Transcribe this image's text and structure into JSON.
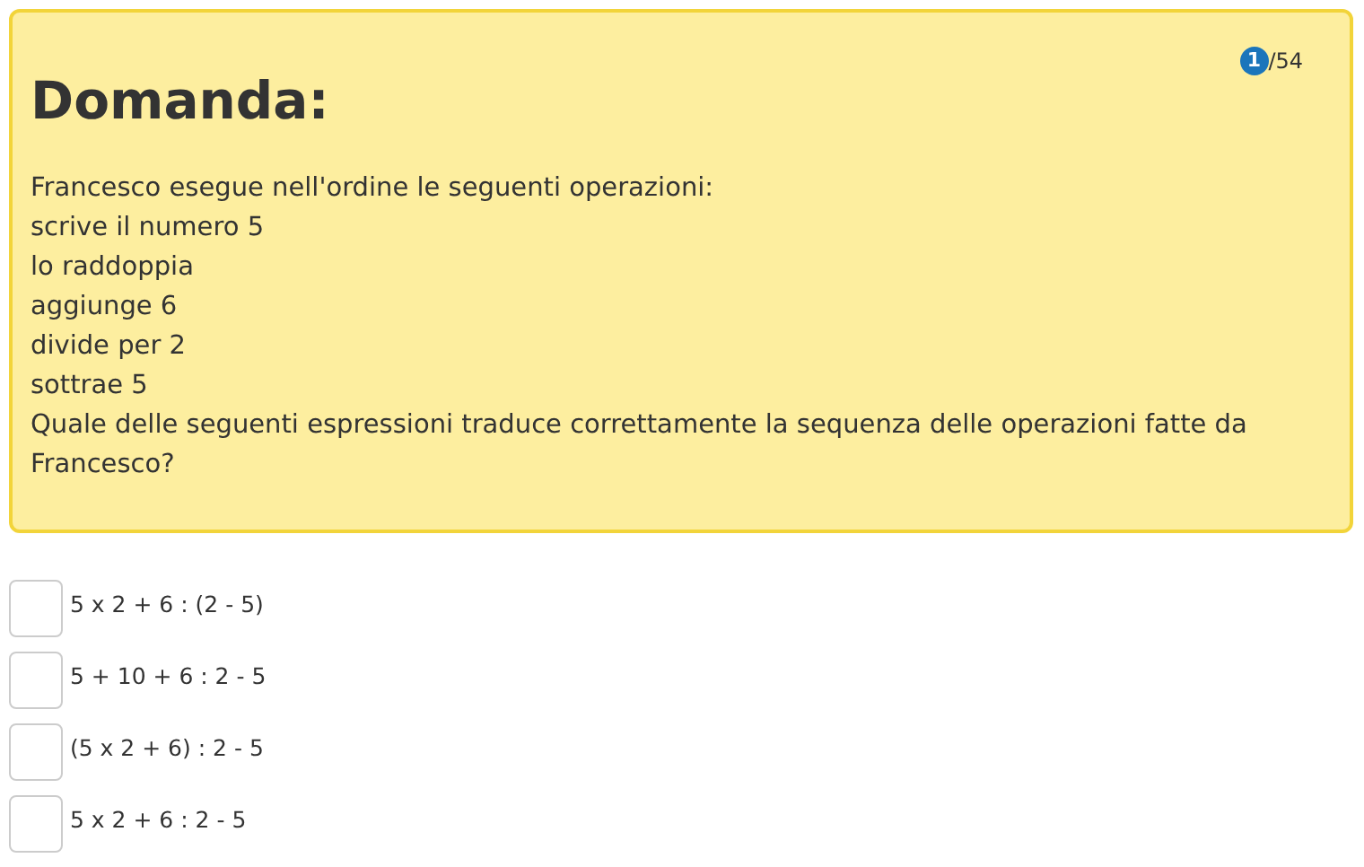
{
  "question": {
    "title": "Domanda:",
    "counter": {
      "current": "1",
      "total": "/54"
    },
    "lines": [
      "Francesco esegue nell'ordine le seguenti operazioni:",
      "scrive il numero 5",
      "lo raddoppia",
      "aggiunge 6",
      "divide per 2",
      "sottrae 5",
      "Quale delle seguenti espressioni traduce correttamente la sequenza delle operazioni fatte da Francesco?"
    ]
  },
  "options": [
    {
      "label": "5 x 2 + 6 : (2 - 5)",
      "checked": false
    },
    {
      "label": "5 + 10 + 6 : 2 - 5",
      "checked": false
    },
    {
      "label": "(5 x 2 + 6) : 2 - 5",
      "checked": false
    },
    {
      "label": "5 x 2 + 6 : 2 - 5",
      "checked": false
    }
  ]
}
